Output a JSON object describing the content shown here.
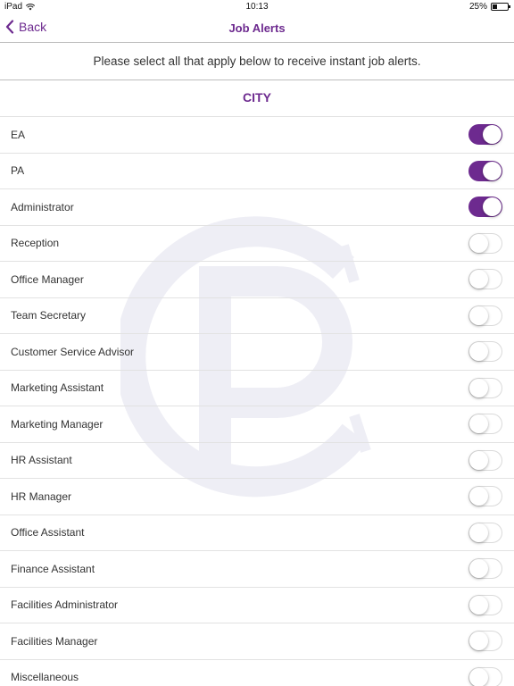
{
  "status_bar": {
    "device": "iPad",
    "time": "10:13",
    "battery": "25%",
    "battery_level": 0.25
  },
  "nav": {
    "back_label": "Back",
    "title": "Job Alerts"
  },
  "instructions": "Please select all that apply below to receive instant job alerts.",
  "section": {
    "title": "CITY"
  },
  "colors": {
    "accent": "#6d2a8f",
    "divider": "#e2e2e2"
  },
  "items": [
    {
      "label": "EA",
      "on": true
    },
    {
      "label": "PA",
      "on": true
    },
    {
      "label": "Administrator",
      "on": true
    },
    {
      "label": "Reception",
      "on": false
    },
    {
      "label": "Office Manager",
      "on": false
    },
    {
      "label": "Team Secretary",
      "on": false
    },
    {
      "label": "Customer Service Advisor",
      "on": false
    },
    {
      "label": "Marketing Assistant",
      "on": false
    },
    {
      "label": "Marketing Manager",
      "on": false
    },
    {
      "label": "HR Assistant",
      "on": false
    },
    {
      "label": "HR Manager",
      "on": false
    },
    {
      "label": "Office Assistant",
      "on": false
    },
    {
      "label": "Finance Assistant",
      "on": false
    },
    {
      "label": "Facilities Administrator",
      "on": false
    },
    {
      "label": "Facilities Manager",
      "on": false
    },
    {
      "label": "Miscellaneous",
      "on": false
    }
  ]
}
